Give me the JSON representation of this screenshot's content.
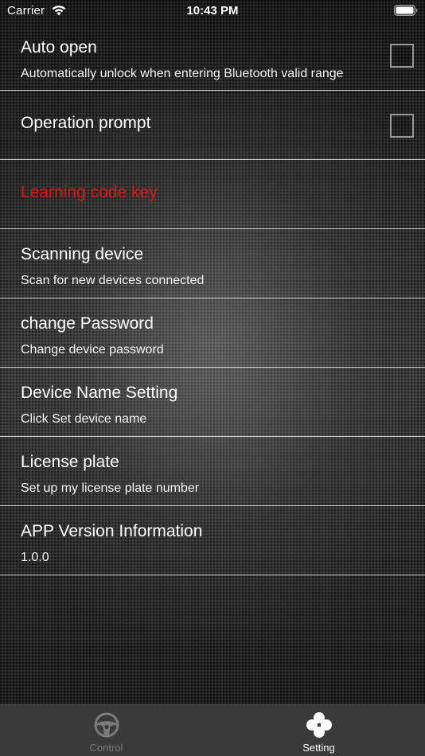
{
  "status_bar": {
    "carrier": "Carrier",
    "time": "10:43 PM"
  },
  "settings": {
    "auto_open": {
      "title": "Auto open",
      "subtitle": "Automatically unlock when entering Bluetooth valid range",
      "checked": false
    },
    "operation_prompt": {
      "title": "Operation prompt",
      "checked": false
    },
    "learning_code_key": {
      "title": "Learning code key",
      "color": "#e01212"
    },
    "scanning_device": {
      "title": "Scanning device",
      "subtitle": "Scan for new devices connected"
    },
    "change_password": {
      "title": "change Password",
      "subtitle": "Change device password"
    },
    "device_name": {
      "title": "Device Name Setting",
      "subtitle": "Click Set device name"
    },
    "license_plate": {
      "title": "License plate",
      "subtitle": "Set up my license plate number"
    },
    "app_version": {
      "title": "APP Version Information",
      "subtitle": "1.0.0"
    }
  },
  "tab_bar": {
    "tabs": [
      {
        "label": "Control",
        "icon": "steering-wheel-icon",
        "selected": false
      },
      {
        "label": "Setting",
        "icon": "clover-icon",
        "selected": true
      }
    ]
  }
}
